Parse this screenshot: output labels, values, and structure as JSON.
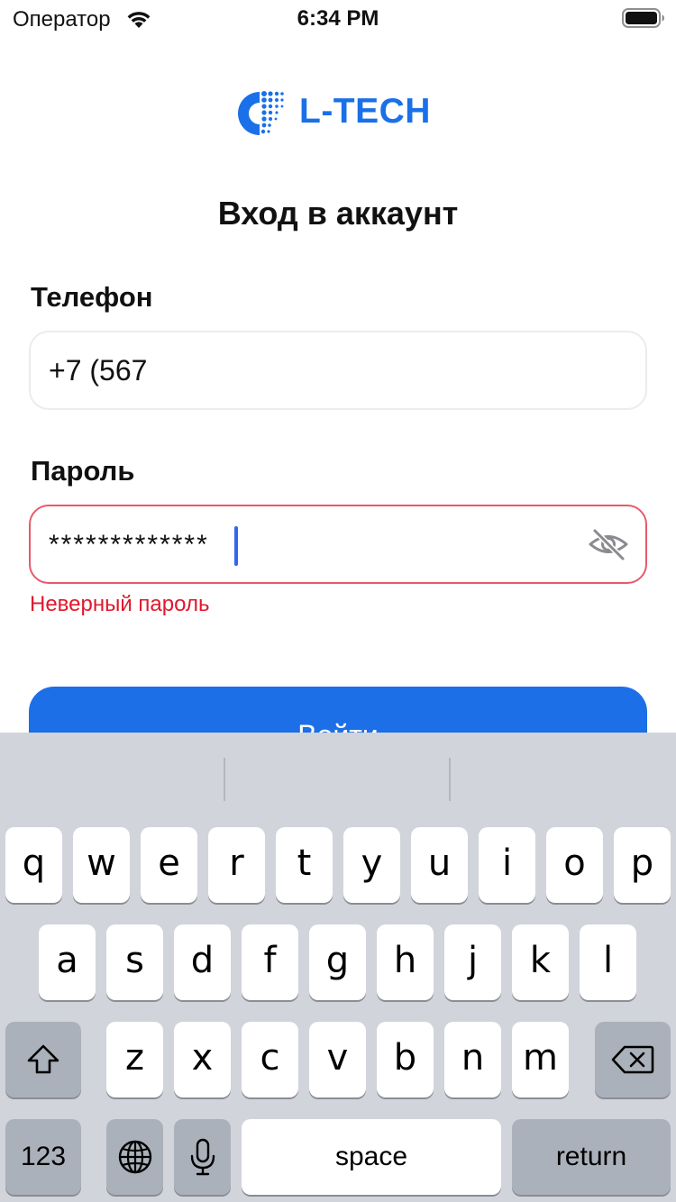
{
  "status_bar": {
    "carrier": "Оператор",
    "time": "6:34 PM"
  },
  "logo": {
    "text": "L-TECH",
    "color": "#1a70e8"
  },
  "page": {
    "title": "Вход в аккаунт"
  },
  "form": {
    "phone_label": "Телефон",
    "phone_value": "+7 (567",
    "password_label": "Пароль",
    "password_value": "*************",
    "password_toggle_icon": "eye-slash-icon",
    "error_message": "Неверный пароль",
    "error_color": "#e0182d",
    "submit_label": "Войти",
    "accent_color": "#1c6fe6"
  },
  "keyboard": {
    "row1": [
      "q",
      "w",
      "e",
      "r",
      "t",
      "y",
      "u",
      "i",
      "o",
      "p"
    ],
    "row2": [
      "a",
      "s",
      "d",
      "f",
      "g",
      "h",
      "j",
      "k",
      "l"
    ],
    "row3": [
      "z",
      "x",
      "c",
      "v",
      "b",
      "n",
      "m"
    ],
    "numbers_label": "123",
    "space_label": "space",
    "return_label": "return",
    "icons": [
      "shift-icon",
      "backspace-icon",
      "globe-icon",
      "microphone-icon"
    ]
  }
}
